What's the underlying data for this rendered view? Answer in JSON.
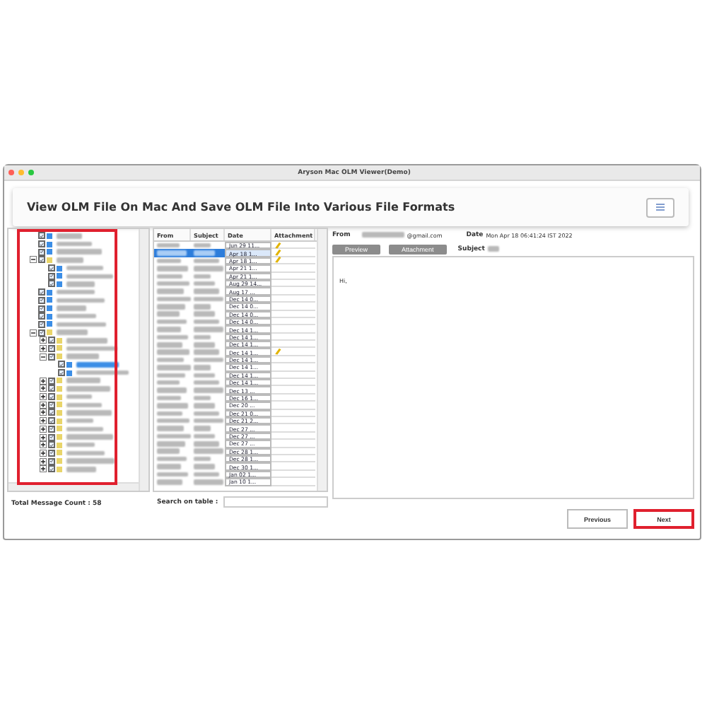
{
  "window": {
    "title": "Aryson Mac OLM Viewer(Demo)"
  },
  "header": {
    "title": "View OLM File On Mac And Save OLM File Into Various File Formats"
  },
  "tree": [
    {
      "kind": "mail",
      "checked": true,
      "selected": false
    },
    {
      "kind": "mail",
      "checked": true,
      "selected": false
    },
    {
      "kind": "mail",
      "checked": true,
      "selected": false
    },
    {
      "kind": "folder",
      "checked": true,
      "selected": false,
      "expanded": true,
      "children": [
        {
          "kind": "mail",
          "checked": true,
          "selected": false
        },
        {
          "kind": "mail",
          "checked": true,
          "selected": false
        },
        {
          "kind": "mail",
          "checked": true,
          "selected": false
        }
      ]
    },
    {
      "kind": "mail",
      "checked": true,
      "selected": false
    },
    {
      "kind": "mail",
      "checked": true,
      "selected": false
    },
    {
      "kind": "mail",
      "checked": true,
      "selected": false
    },
    {
      "kind": "mail",
      "checked": true,
      "selected": false
    },
    {
      "kind": "mail",
      "checked": true,
      "selected": false
    },
    {
      "kind": "folder",
      "checked": true,
      "selected": false,
      "expanded": true,
      "children": [
        {
          "kind": "folder",
          "checked": true,
          "selected": false,
          "expanded": false
        },
        {
          "kind": "folder",
          "checked": true,
          "selected": false,
          "expanded": false
        },
        {
          "kind": "folder",
          "checked": true,
          "selected": false,
          "expanded": true,
          "children": [
            {
              "kind": "mail",
              "checked": true,
              "selected": true
            },
            {
              "kind": "mail",
              "checked": true,
              "selected": false
            }
          ]
        },
        {
          "kind": "folder",
          "checked": true,
          "selected": false,
          "expanded": false
        },
        {
          "kind": "folder",
          "checked": true,
          "selected": false,
          "expanded": false
        },
        {
          "kind": "folder",
          "checked": true,
          "selected": false,
          "expanded": false
        },
        {
          "kind": "folder",
          "checked": true,
          "selected": false,
          "expanded": false
        },
        {
          "kind": "folder",
          "checked": true,
          "selected": false,
          "expanded": false
        },
        {
          "kind": "folder",
          "checked": true,
          "selected": false,
          "expanded": false
        },
        {
          "kind": "folder",
          "checked": true,
          "selected": false,
          "expanded": false
        },
        {
          "kind": "folder",
          "checked": true,
          "selected": false,
          "expanded": false
        },
        {
          "kind": "folder",
          "checked": true,
          "selected": false,
          "expanded": false
        },
        {
          "kind": "folder",
          "checked": true,
          "selected": false,
          "expanded": false
        },
        {
          "kind": "folder",
          "checked": true,
          "selected": false,
          "expanded": false
        },
        {
          "kind": "folder",
          "checked": true,
          "selected": false,
          "expanded": false
        }
      ]
    }
  ],
  "total_count": "Total Message Count : 58",
  "mail_list": {
    "columns": [
      "From",
      "Subject",
      "Date",
      "Attachment"
    ],
    "rows": [
      {
        "date": "Jun 29 11...",
        "attachment": true,
        "selected": false
      },
      {
        "date": "Apr 18 1...",
        "attachment": true,
        "selected": true
      },
      {
        "date": "Apr 18 1...",
        "attachment": true,
        "selected": false
      },
      {
        "date": "Apr 21 1...",
        "attachment": false,
        "selected": false
      },
      {
        "date": "Apr 21 1...",
        "attachment": false,
        "selected": false
      },
      {
        "date": "Aug 29 14...",
        "attachment": false,
        "selected": false
      },
      {
        "date": "Aug 17 ...",
        "attachment": false,
        "selected": false
      },
      {
        "date": "Dec 14 0...",
        "attachment": false,
        "selected": false
      },
      {
        "date": "Dec 14 0...",
        "attachment": false,
        "selected": false
      },
      {
        "date": "Dec 14 0...",
        "attachment": false,
        "selected": false
      },
      {
        "date": "Dec 14 0...",
        "attachment": false,
        "selected": false
      },
      {
        "date": "Dec 14 1...",
        "attachment": false,
        "selected": false
      },
      {
        "date": "Dec 14 1...",
        "attachment": false,
        "selected": false
      },
      {
        "date": "Dec 14 1...",
        "attachment": false,
        "selected": false
      },
      {
        "date": "Dec 14 1...",
        "attachment": true,
        "selected": false
      },
      {
        "date": "Dec 14 1...",
        "attachment": false,
        "selected": false
      },
      {
        "date": "Dec 14 1...",
        "attachment": false,
        "selected": false
      },
      {
        "date": "Dec 14 1...",
        "attachment": false,
        "selected": false
      },
      {
        "date": "Dec 14 1...",
        "attachment": false,
        "selected": false
      },
      {
        "date": "Dec 13 ...",
        "attachment": false,
        "selected": false
      },
      {
        "date": "Dec 16 1...",
        "attachment": false,
        "selected": false
      },
      {
        "date": "Dec 20 ...",
        "attachment": false,
        "selected": false
      },
      {
        "date": "Dec 21 0...",
        "attachment": false,
        "selected": false
      },
      {
        "date": "Dec 21 2...",
        "attachment": false,
        "selected": false
      },
      {
        "date": "Dec 27 ...",
        "attachment": false,
        "selected": false
      },
      {
        "date": "Dec 27 ...",
        "attachment": false,
        "selected": false
      },
      {
        "date": "Dec 27 ...",
        "attachment": false,
        "selected": false
      },
      {
        "date": "Dec 28 1...",
        "attachment": false,
        "selected": false
      },
      {
        "date": "Dec 28 1...",
        "attachment": false,
        "selected": false
      },
      {
        "date": "Dec 30 1...",
        "attachment": false,
        "selected": false
      },
      {
        "date": "Jan 02 1...",
        "attachment": false,
        "selected": false
      },
      {
        "date": "Jan 10 1...",
        "attachment": false,
        "selected": false
      }
    ]
  },
  "search": {
    "label": "Search on table :"
  },
  "preview": {
    "from_label": "From",
    "from_domain": "@gmail.com",
    "date_label": "Date",
    "date": "Mon Apr 18 06:41:24 IST 2022",
    "subject_label": "Subject",
    "buttons": [
      "Preview",
      "Attachment"
    ],
    "body": "Hi,"
  },
  "nav_buttons": [
    {
      "label": "Previous",
      "highlighted": false
    },
    {
      "label": "Next",
      "highlighted": true
    }
  ]
}
